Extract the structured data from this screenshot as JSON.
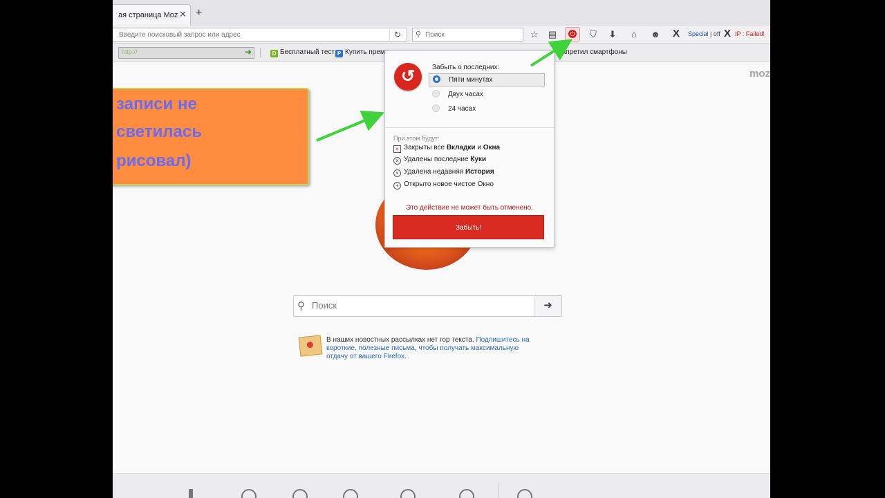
{
  "tab": {
    "title": "ая страница Mozilla ...",
    "close": "✕",
    "new": "+"
  },
  "navbar": {
    "url_placeholder": "Введите поисковый запрос или адрес",
    "reload": "↻",
    "search_placeholder": "Поиск",
    "special": "Special",
    "special_sep": " | off",
    "ip_status": "IP : Failed!"
  },
  "bookmarks": {
    "url_text": "http://",
    "items": [
      {
        "label": "Бесплатный тест",
        "icon_letter": "D",
        "color": "#79b51c"
      },
      {
        "label": "Купить преми",
        "icon_letter": "P",
        "color": "#2e6fd0"
      }
    ],
    "partial": "запретил смартфоны"
  },
  "content": {
    "brand": "moz",
    "overlay_lines": [
      "записи не",
      "светилась",
      "рисовал)"
    ],
    "search_placeholder": "Поиск",
    "snippet_text": "В наших новостных рассылках нет гор текста. ",
    "snippet_link": "Подпишитесь на короткие, полезные письма, чтобы получать максимальную отдачу от вашего Firefox."
  },
  "panel": {
    "heading": "Забыть о последних:",
    "options": [
      "Пяти минутах",
      "Двух часах",
      "24 часах"
    ],
    "selected_index": 0,
    "results_heading": "При этом будут:",
    "r1_a": "Закрыты все ",
    "r1_b": "Вкладки",
    "r1_c": " и ",
    "r1_d": "Окна",
    "r2_a": "Удалены последние ",
    "r2_b": "Куки",
    "r3_a": "Удалена недавняя ",
    "r3_b": "История",
    "r4": "Открыто новое чистое Окно",
    "warning": "Это действие не может быть отменено.",
    "button": "Забыть!"
  },
  "colors": {
    "accent_red": "#d72a20",
    "arrow_green": "#3fd23a",
    "overlay_orange": "#ff8c3f"
  }
}
